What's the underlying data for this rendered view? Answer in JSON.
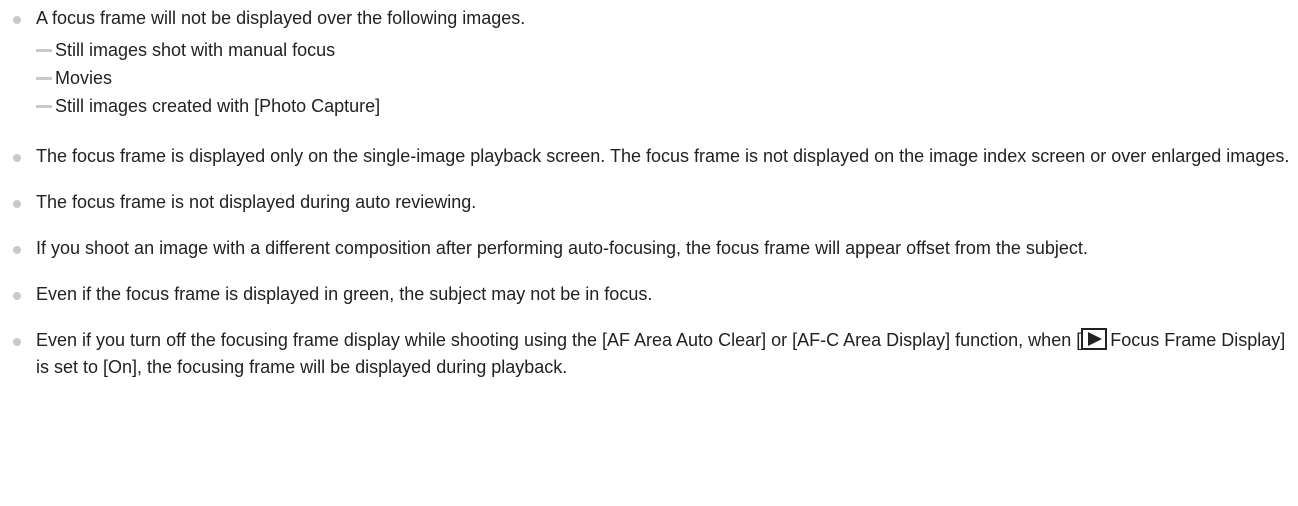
{
  "notes": [
    {
      "text": "A focus frame will not be displayed over the following images.",
      "subitems": [
        "Still images shot with manual focus",
        "Movies",
        "Still images created with [Photo Capture]"
      ]
    },
    {
      "text": "The focus frame is displayed only on the single-image playback screen. The focus frame is not displayed on the image index screen or over enlarged images."
    },
    {
      "text": "The focus frame is not displayed during auto reviewing."
    },
    {
      "text": "If you shoot an image with a different composition after performing auto-focusing, the focus frame will appear offset from the subject."
    },
    {
      "text": "Even if the focus frame is displayed in green, the subject may not be in focus."
    },
    {
      "text_before_icon": "Even if you turn off the focusing frame display while shooting using the [AF Area Auto Clear] or [AF-C Area Display] function, when [",
      "icon": "playback-icon",
      "text_after_icon": "Focus Frame Display] is set to [On], the focusing frame will be displayed during playback."
    }
  ]
}
